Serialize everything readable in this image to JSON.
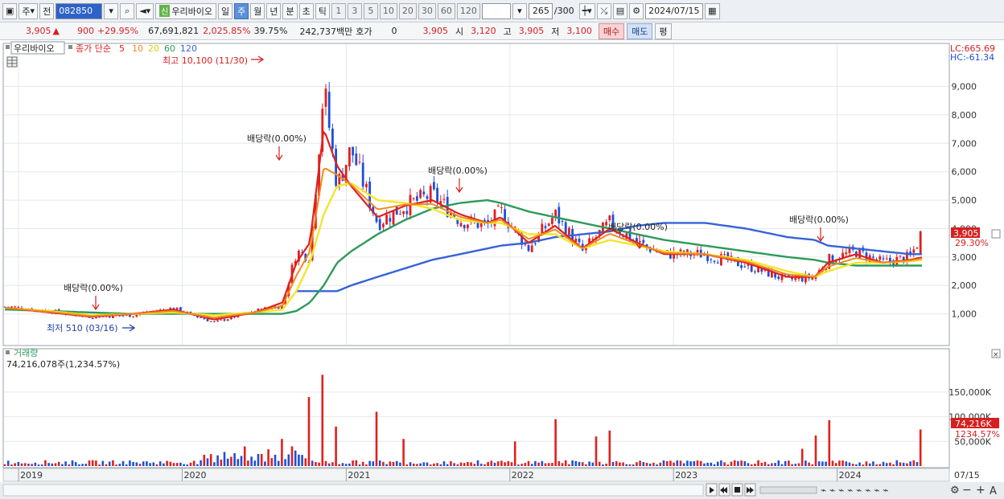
{
  "toolbar": {
    "period_type": "주",
    "prev_label": "전",
    "code": "082850",
    "new_badge": "신",
    "stock_name": "우리바이오",
    "periods": [
      "일",
      "주",
      "월",
      "년",
      "분",
      "초",
      "틱"
    ],
    "active_period": "주",
    "period_numbers": [
      "1",
      "3",
      "5",
      "10",
      "20",
      "30",
      "60",
      "120"
    ],
    "count_value": "265",
    "count_total": "/300",
    "date": "2024/07/15"
  },
  "quote": {
    "price": "3,905",
    "change": "900",
    "change_pct": "+29.95%",
    "volume": "67,691,821",
    "volume_ratio": "2,025.85%",
    "turnover": "39.75%",
    "amount": "242,737백만",
    "hoga_label": "호가",
    "hoga_value": "0",
    "hoga_price": "3,905",
    "open_label": "시",
    "open": "3,120",
    "high_label": "고",
    "high": "3,905",
    "low_label": "저",
    "low": "3,100",
    "buy_label": "매수",
    "sell_label": "매도",
    "avg_label": "평"
  },
  "legend": {
    "name": "우리바이오",
    "ma_prefix": "종가 단순",
    "ma_periods": [
      "5",
      "10",
      "20",
      "60",
      "120"
    ]
  },
  "colors": {
    "up": "#e0201e",
    "down": "#1f4fd8",
    "ma5": "#e0201e",
    "ma10": "#f08a1c",
    "ma20": "#f2e62a",
    "ma60": "#2e9a5a",
    "ma120": "#3563d8"
  },
  "chart_data": {
    "type": "candlestick",
    "x_ticks": [
      "2019",
      "2020",
      "2021",
      "2022",
      "2023",
      "2024",
      "07/15"
    ],
    "y_ticks": [
      "1,000",
      "2,000",
      "3,000",
      "4,000",
      "5,000",
      "6,000",
      "7,000",
      "8,000",
      "9,000"
    ],
    "ylim": [
      0,
      10400
    ],
    "price_series": {
      "dates": [
        "2018-12",
        "2019-03",
        "2019-06",
        "2019-09",
        "2019-12",
        "2020-03",
        "2020-06",
        "2020-08",
        "2020-09",
        "2020-10",
        "2020-11",
        "2020-12",
        "2021-01",
        "2021-03",
        "2021-05",
        "2021-07",
        "2021-09",
        "2021-11",
        "2021-12",
        "2022-02",
        "2022-04",
        "2022-06",
        "2022-08",
        "2022-10",
        "2022-12",
        "2023-03",
        "2023-06",
        "2023-09",
        "2023-11",
        "2023-12",
        "2024-02",
        "2024-04",
        "2024-06",
        "2024-07"
      ],
      "close": [
        1250,
        1100,
        900,
        950,
        1200,
        700,
        1100,
        1300,
        3200,
        3000,
        9000,
        5500,
        6800,
        4200,
        4800,
        5200,
        4300,
        4100,
        4600,
        3300,
        4500,
        3200,
        4200,
        3500,
        3100,
        3100,
        2700,
        2200,
        2300,
        2900,
        3200,
        2800,
        3000,
        3905
      ]
    },
    "ma_series": {
      "5": [
        1200,
        1050,
        900,
        1000,
        1150,
        800,
        1050,
        1400,
        2800,
        3500,
        7500,
        6200,
        5500,
        4400,
        4800,
        5000,
        4500,
        4200,
        4400,
        3500,
        4100,
        3300,
        4000,
        3500,
        3100,
        3100,
        2800,
        2300,
        2300,
        2800,
        3100,
        2800,
        2900,
        3000
      ],
      "20": [
        1200,
        1100,
        950,
        1000,
        1050,
        950,
        1050,
        1150,
        1800,
        2800,
        4500,
        5500,
        5600,
        5000,
        4900,
        4700,
        4300,
        4200,
        4200,
        3800,
        3800,
        3300,
        3600,
        3400,
        3200,
        3100,
        2900,
        2500,
        2300,
        2500,
        2800,
        2800,
        2850,
        2900
      ],
      "60": [
        1150,
        1100,
        1050,
        1000,
        1000,
        1000,
        1000,
        1000,
        1100,
        1400,
        2000,
        2800,
        3200,
        3800,
        4300,
        4700,
        4900,
        5000,
        4900,
        4600,
        4400,
        4200,
        4000,
        3800,
        3600,
        3400,
        3200,
        3000,
        2900,
        2800,
        2700,
        2700,
        2700,
        2700
      ],
      "120": [
        null,
        null,
        null,
        null,
        null,
        null,
        null,
        null,
        null,
        null,
        null,
        1800,
        2000,
        2300,
        2600,
        2900,
        3100,
        3300,
        3400,
        3500,
        3700,
        3800,
        3900,
        4100,
        4200,
        4200,
        4000,
        3700,
        3600,
        3400,
        3300,
        3200,
        3100,
        3100
      ]
    },
    "annotations": {
      "max_label": "최고 10,100 (11/30)",
      "min_label": "최저 510 (03/16)",
      "dividend_label": "배당락(0.00%)",
      "lc_label": "LC:665.69",
      "hc_label": "HC:-61.34",
      "last_price": "3,905",
      "last_change": "29.30%"
    },
    "volume": {
      "title": "거래량",
      "current": "74,216,078주(1,234.57%)",
      "y_ticks": [
        "50,000K",
        "100,000K",
        "150,000K"
      ],
      "last_label": "74,216K",
      "last_pct": "1234.57%",
      "spikes": [
        {
          "date": "2020-08",
          "value": 55000
        },
        {
          "date": "2020-10",
          "value": 140000
        },
        {
          "date": "2020-11",
          "value": 185000
        },
        {
          "date": "2020-12",
          "value": 80000
        },
        {
          "date": "2021-03",
          "value": 110000
        },
        {
          "date": "2021-05",
          "value": 55000
        },
        {
          "date": "2022-01",
          "value": 50000
        },
        {
          "date": "2022-04",
          "value": 95000
        },
        {
          "date": "2022-07",
          "value": 60000
        },
        {
          "date": "2022-08",
          "value": 72000
        },
        {
          "date": "2023-10",
          "value": 35000
        },
        {
          "date": "2023-11",
          "value": 62000
        },
        {
          "date": "2023-12",
          "value": 93000
        },
        {
          "date": "2024-07",
          "value": 74216
        }
      ]
    }
  }
}
